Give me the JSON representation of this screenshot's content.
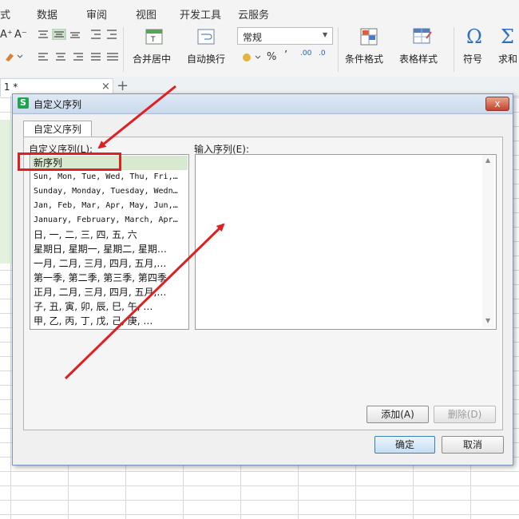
{
  "ribbon": {
    "tabs": [
      "式",
      "数据",
      "审阅",
      "视图",
      "开发工具",
      "云服务"
    ],
    "merge_center": "合并居中",
    "auto_wrap": "自动换行",
    "number_format": "常规",
    "percent": "%",
    "comma": "’",
    "dec_inc": ".00",
    "dec_dec": ".0",
    "conditional_format": "条件格式",
    "table_style": "表格样式",
    "symbol": "符号",
    "formula": "求和",
    "font_inc": "A⁺",
    "font_dec": "A⁻"
  },
  "sheet": {
    "tab_label": " 1 *",
    "close": "×",
    "add": "+"
  },
  "dialog": {
    "title": "自定义序列",
    "tab": "自定义序列",
    "left_label": "自定义序列(L):",
    "right_label": "输入序列(E):",
    "list": [
      "新序列",
      "Sun, Mon, Tue, Wed, Thu, Fri,…",
      "Sunday, Monday, Tuesday, Wedn…",
      "Jan, Feb, Mar, Apr, May, Jun,…",
      "January, February, March, Apr…",
      "日, 一, 二, 三, 四, 五, 六",
      "星期日, 星期一, 星期二, 星期…",
      "一月, 二月, 三月, 四月, 五月,…",
      "第一季, 第二季, 第三季, 第四季",
      "正月, 二月, 三月, 四月, 五月,…",
      "子, 丑, 寅, 卯, 辰, 巳, 午, …",
      "甲, 乙, 丙, 丁, 戊, 己, 庚, …"
    ],
    "add_button": "添加(A)",
    "delete_button": "删除(D)",
    "ok_button": "确定",
    "cancel_button": "取消",
    "close_glyph": "x"
  },
  "colors": {
    "annotation_red": "#e02020",
    "selected_row": "#d7e9cf",
    "app_icon_green": "#1fa34c"
  }
}
